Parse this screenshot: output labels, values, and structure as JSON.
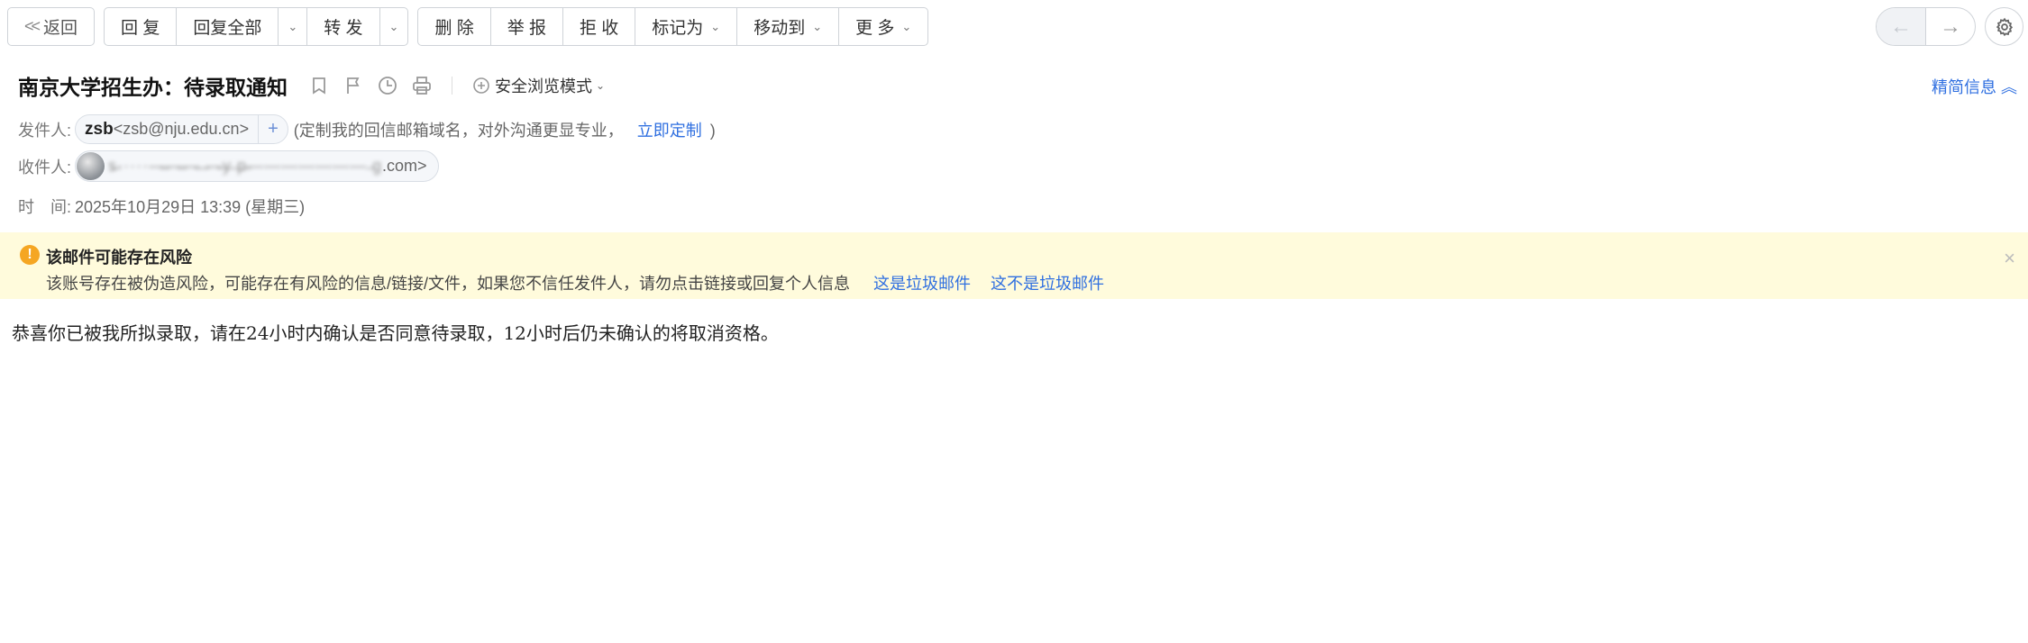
{
  "toolbar": {
    "back": "返回",
    "reply": "回 复",
    "reply_all": "回复全部",
    "forward": "转 发",
    "delete": "删 除",
    "report": "举 报",
    "reject": "拒 收",
    "mark_as": "标记为",
    "move_to": "移动到",
    "more": "更 多"
  },
  "nav": {
    "prev_glyph": "←",
    "next_glyph": "→"
  },
  "header": {
    "subject": "南京大学招生办：待录取通知",
    "safe_mode": "安全浏览模式",
    "brief_toggle": "精简信息",
    "from_label": "发件人:",
    "from_name": "zsb",
    "from_address": "<zsb@nju.edu.cn>",
    "from_hint_prefix": "(定制我的回信邮箱域名，对外沟通更显专业，",
    "from_hint_link": "立即定制",
    "from_hint_suffix": ")",
    "to_label": "收件人:",
    "to_masked": "s̶·····—̶—̶—̶ ̶—̶y̶ ̶p̶——————— ̶g",
    "to_suffix": ".com>",
    "time_label": "时　间:",
    "time_value": "2025年10月29日 13:39 (星期三)"
  },
  "warning": {
    "title": "该邮件可能存在风险",
    "description": "该账号存在被伪造风险，可能存在有风险的信息/链接/文件，如果您不信任发件人，请勿点击链接或回复个人信息",
    "spam_link": "这是垃圾邮件",
    "not_spam_link": "这不是垃圾邮件",
    "close_glyph": "×"
  },
  "body": {
    "text": "恭喜你已被我所拟录取，请在24小时内确认是否同意待录取，12小时后仍未确认的将取消资格。"
  },
  "icons": [
    "bookmark-icon",
    "flag-icon",
    "clock-icon",
    "print-icon",
    "shield-icon",
    "gear-icon",
    "warning-icon"
  ],
  "colors": {
    "link": "#2f6fe0",
    "warning_bg": "#fffbdc",
    "warning_icon": "#f5a623"
  }
}
